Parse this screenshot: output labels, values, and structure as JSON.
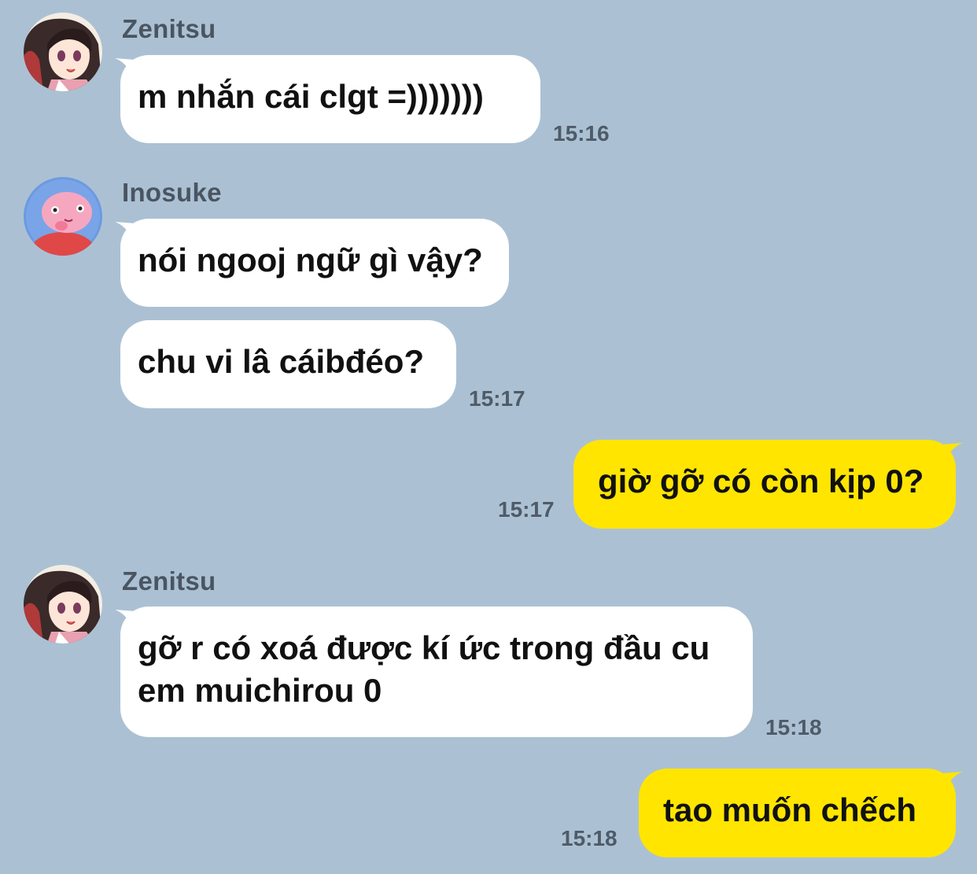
{
  "chat": {
    "messages": [
      {
        "sender": "Zenitsu",
        "avatar": "anime-girl-avatar",
        "text": "m nhắn cái clgt =)))))))",
        "time": "15:16"
      },
      {
        "sender": "Inosuke",
        "avatar": "pink-pig-avatar",
        "text": "nói ngooj ngữ gì vậy?"
      },
      {
        "text": "chu vi lâ cáibđéo?",
        "time": "15:17"
      },
      {
        "outgoing": true,
        "text": "giờ gỡ có còn kịp 0?",
        "time": "15:17"
      },
      {
        "sender": "Zenitsu",
        "avatar": "anime-girl-avatar",
        "line1": "gỡ r có xoá được kí ức trong đầu cu",
        "line2": "em muichirou 0",
        "time": "15:18"
      },
      {
        "outgoing": true,
        "text": "tao muốn chếch",
        "time": "15:18"
      }
    ]
  },
  "colors": {
    "background": "#abc1d3",
    "incoming_bubble": "#ffffff",
    "outgoing_bubble": "#ffe500"
  }
}
